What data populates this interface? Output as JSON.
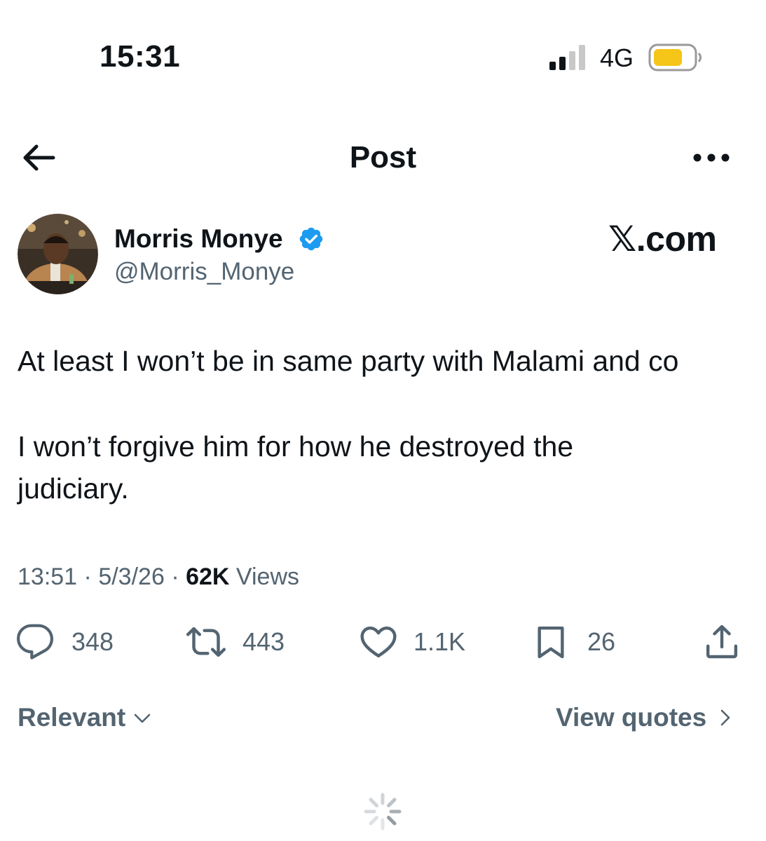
{
  "status_bar": {
    "time": "15:31",
    "network": "4G"
  },
  "nav": {
    "title": "Post"
  },
  "author": {
    "name": "Morris Monye",
    "handle": "@Morris_Monye",
    "verified_color": "#1d9bf0"
  },
  "watermark": "𝕏.com",
  "post": {
    "lines": [
      "At least I won’t be in same party with Malami and co",
      "I won’t forgive him for how he destroyed the",
      "judiciary."
    ]
  },
  "meta": {
    "time": "13:51",
    "date": "5/3/26",
    "views_count": "62K",
    "views_label": "Views",
    "sep": "·"
  },
  "actions": {
    "replies": "348",
    "reposts": "443",
    "likes": "1.1K",
    "bookmarks": "26"
  },
  "footer": {
    "sort_label": "Relevant",
    "view_quotes_label": "View quotes"
  },
  "colors": {
    "text": "#0f1419",
    "secondary": "#536471",
    "battery": "#f5c518",
    "accent": "#1d9bf0"
  },
  "icons": [
    "signal-icon",
    "battery-icon",
    "back-arrow-icon",
    "more-icon",
    "verified-icon",
    "reply-icon",
    "repost-icon",
    "like-icon",
    "bookmark-icon",
    "share-icon",
    "chevron-down-icon",
    "chevron-right-icon",
    "spinner-icon"
  ]
}
